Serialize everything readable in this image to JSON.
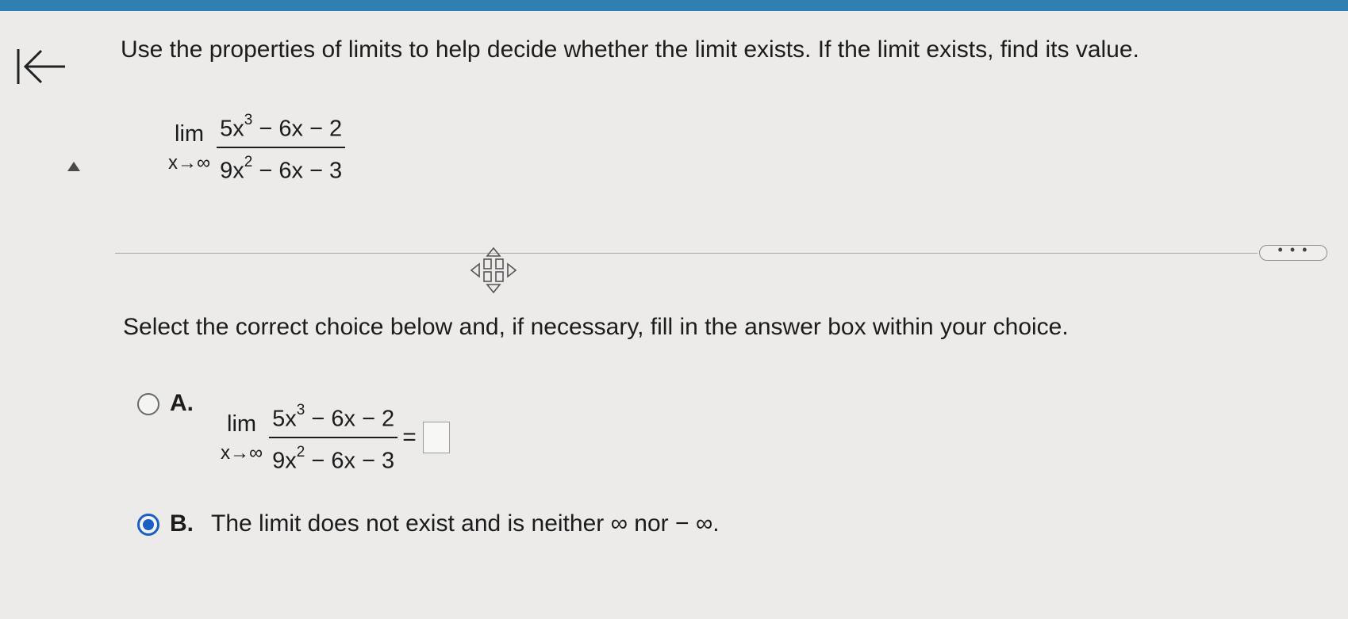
{
  "question": {
    "instruction": "Use the properties of limits to help decide whether the limit exists. If the limit exists, find its value.",
    "limit": {
      "lim_word": "lim",
      "subscript": "x→∞",
      "numerator": {
        "coef": "5x",
        "exp": "3",
        "rest": " − 6x − 2"
      },
      "denominator": {
        "coef": "9x",
        "exp": "2",
        "rest": " − 6x − 3"
      }
    }
  },
  "more_button": {
    "label": "• • •"
  },
  "prompt": "Select the correct choice below and, if necessary, fill in the answer box within your choice.",
  "choices": {
    "a": {
      "letter": "A.",
      "selected": false,
      "limit": {
        "lim_word": "lim",
        "subscript": "x→∞",
        "numerator": {
          "coef": "5x",
          "exp": "3",
          "rest": " − 6x − 2"
        },
        "denominator": {
          "coef": "9x",
          "exp": "2",
          "rest": " − 6x − 3"
        }
      },
      "equals": "=",
      "answer_value": ""
    },
    "b": {
      "letter": "B.",
      "selected": true,
      "text": "The limit does not exist and is neither ∞ nor − ∞."
    }
  },
  "colors": {
    "top_bar": "#2f7fb0",
    "selected_radio": "#1a5fc4",
    "background": "#ecebea"
  },
  "icons": [
    "back-arrow-icon",
    "collapse-triangle-icon",
    "move-cursor-icon"
  ]
}
